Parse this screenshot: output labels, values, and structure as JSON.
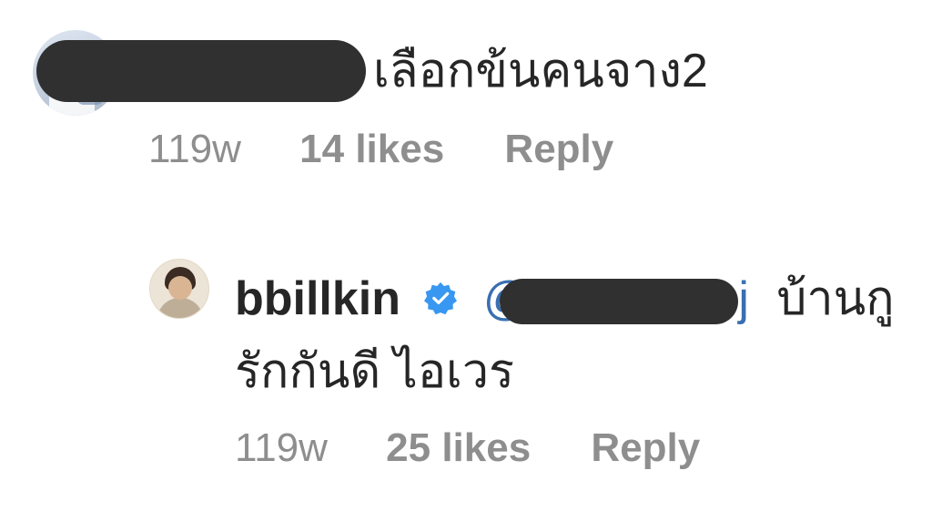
{
  "comments": [
    {
      "username": "",
      "text": "เลือกข้นคนจาง2",
      "time": "119w",
      "likes": "14 likes",
      "reply_label": "Reply"
    },
    {
      "username": "bbillkin",
      "verified": true,
      "mention_start": "@",
      "mention_end": "j",
      "text_line1": "บ้านกู",
      "text_line2": "รักกันดี ไอเวร",
      "time": "119w",
      "likes": "25 likes",
      "reply_label": "Reply"
    }
  ],
  "colors": {
    "text_primary": "#262626",
    "text_secondary": "#8e8e8e",
    "verified_blue": "#3897f0",
    "mention_blue": "#3a6fb0",
    "redaction": "#303030"
  }
}
